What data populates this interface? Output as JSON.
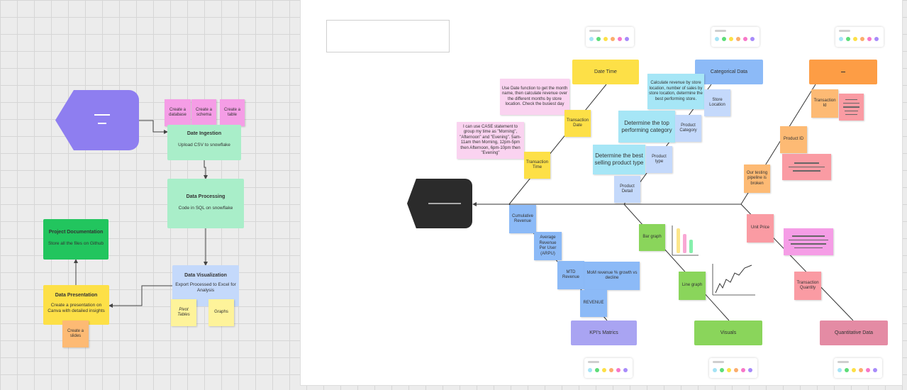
{
  "left_flow": {
    "ingestion": {
      "title": "Date Ingestion",
      "desc": "Upload CSV to snowflake"
    },
    "processing": {
      "title": "Data Processing",
      "desc": "Code in SQL on snowflake"
    },
    "visualization": {
      "title": "Data Visualization",
      "desc": "Export Processed to Excel for Analysis"
    },
    "presentation": {
      "title": "Data Presentation",
      "desc": "Create a presentation on Canva with detailed insights"
    },
    "documentation": {
      "title": "Project Documentation",
      "desc": "Store all the files on Github"
    },
    "stickies": {
      "create_database": "Create a database",
      "create_schema": "Create a schema",
      "create_table": "Create a table",
      "pivot_tables": "Pivot Tables",
      "graphs": "Graphs",
      "create_slides": "Create a slides"
    }
  },
  "fishbone": {
    "headers": {
      "date_time": "Date Time",
      "categorical": "Categorical Data",
      "kpis": "KPI's Matrics",
      "visuals": "Visuals",
      "quantitative": "Quantitative Data"
    },
    "stickies": {
      "date_function": "Use Date function to get the month name, then calculate revenue over the different months by store location. Check the busiest day",
      "case_statement": "I can use CASE statement to group my time as \"Morning\", \"Afternoon\" and \"Evening\". 5am-11am then Morning, 12pm-5pm then Afternoon, 6pm-10pm then \"Evening\"",
      "transaction_date": "Transaction Date",
      "transaction_time": "Transaction Time",
      "calc_revenue": "Calculate revenue by store location, number of sales by store location, determine the best performing store.",
      "store_location": "Store Location",
      "top_category": "Determine the top performing category",
      "product_category": "Product Category",
      "best_product_type": "Determine the best selling product type",
      "product_type": "Product type",
      "product_detail": "Product Detail",
      "transaction_id": "Transaction Id",
      "product_id": "Product ID",
      "pipeline_broken": "Our testing pipeline is broken",
      "unit_price": "Unit Price",
      "transaction_quantity": "Transaction Quantity",
      "cumulative_revenue": "Cumulative Revenue",
      "arpu": "Average Revenue Per User (ARPU)",
      "mtd_revenue": "MTD Revenue",
      "mom_growth": "MoM revenue % growth vs decline",
      "revenue": "REVENUE",
      "bar_graph": "Bar graph",
      "line_graph": "Line graph"
    }
  },
  "colors": {
    "purple": "#8e7ef0",
    "pink": "#f59de6",
    "mint": "#a9eec9",
    "blue_light": "#c4d9fb",
    "green": "#22c55e",
    "yellow": "#fde047",
    "orange": "#fdba74",
    "dark": "#2b2b2b",
    "kpi_purple": "#a9a4f2",
    "visuals_green": "#8ad55b",
    "quant_pink": "#e48ba4",
    "cat_blue": "#8cbaf7",
    "orange_head": "#fd9d45"
  },
  "toolbar_dots": [
    "#a5e3f5",
    "#5ddd78",
    "#fde047",
    "#fbad6c",
    "#f777c8",
    "#a78bfa"
  ]
}
